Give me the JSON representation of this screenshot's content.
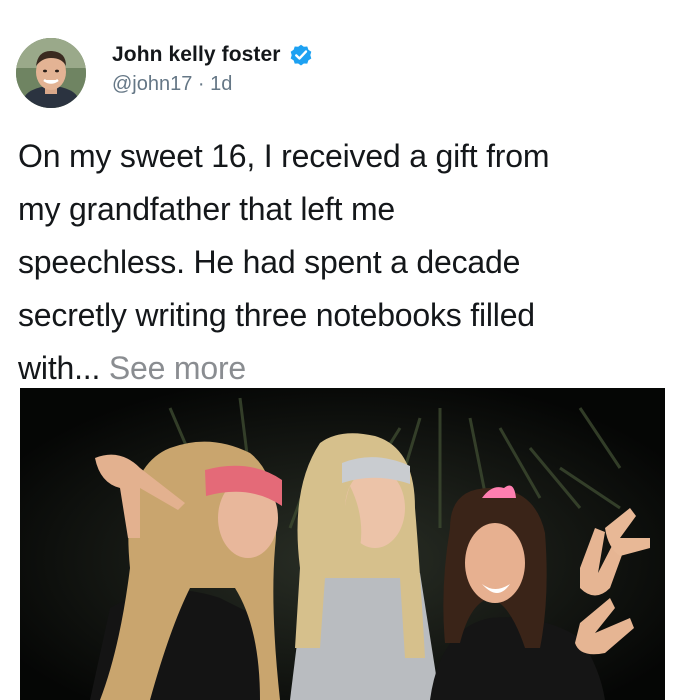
{
  "author": {
    "display_name": "John kelly foster",
    "handle": "@john17",
    "separator": " · ",
    "timestamp": "1d",
    "verified": true
  },
  "tweet": {
    "lines": [
      "On my sweet 16, I received a gift from",
      "my grandfather that left me",
      "speechless. He had spent a decade",
      "secretly writing three notebooks filled"
    ],
    "last_line_text": "with... ",
    "see_more_label": "See more"
  },
  "media": {
    "type": "photo",
    "subject": "three-girls-posing-at-night-icon"
  },
  "colors": {
    "verified_blue": "#1da1f2",
    "text": "#14171a",
    "muted": "#657786",
    "see_more": "#8a8d91"
  }
}
